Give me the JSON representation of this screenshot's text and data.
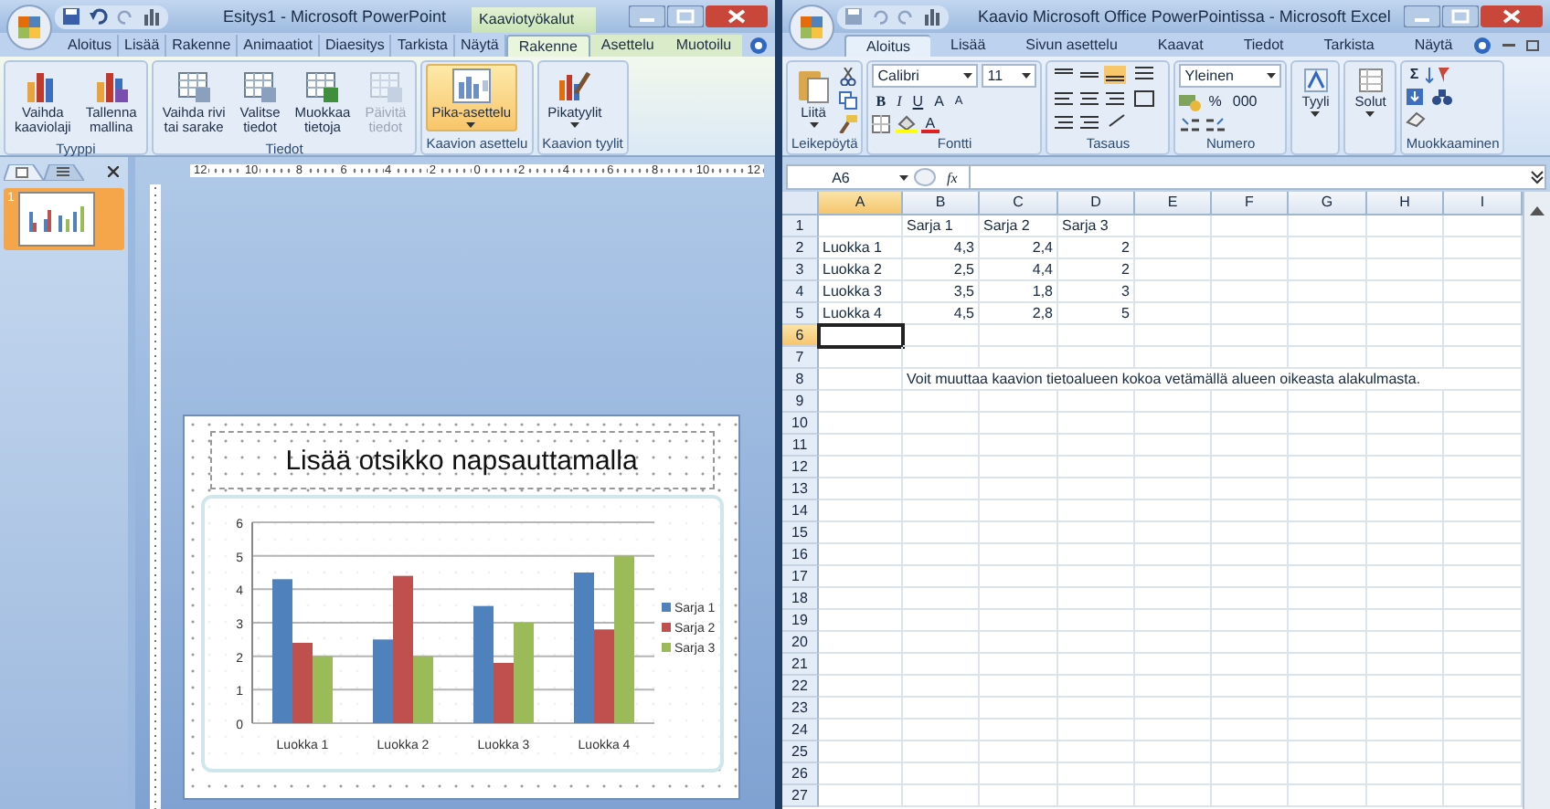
{
  "powerpoint": {
    "title": "Esitys1 - Microsoft PowerPoint",
    "context_title": "Kaaviotyökalut",
    "tabs": [
      {
        "label": "Aloitus",
        "selected": false,
        "contextual": false
      },
      {
        "label": "Lisää",
        "selected": false,
        "contextual": false
      },
      {
        "label": "Rakenne",
        "selected": false,
        "contextual": false
      },
      {
        "label": "Animaatiot",
        "selected": false,
        "contextual": false
      },
      {
        "label": "Diaesitys",
        "selected": false,
        "contextual": false
      },
      {
        "label": "Tarkista",
        "selected": false,
        "contextual": false
      },
      {
        "label": "Näytä",
        "selected": false,
        "contextual": false
      },
      {
        "label": "Rakenne",
        "selected": true,
        "contextual": true
      },
      {
        "label": "Asettelu",
        "selected": false,
        "contextual": true
      },
      {
        "label": "Muotoilu",
        "selected": false,
        "contextual": true
      }
    ],
    "groups": [
      {
        "label": "Tyyppi",
        "buttons": [
          {
            "label": "Vaihda\nkaaviolaji",
            "disabled": false,
            "pressed": false,
            "dropdown": false
          },
          {
            "label": "Tallenna\nmallina",
            "disabled": false,
            "pressed": false,
            "dropdown": false
          }
        ]
      },
      {
        "label": "Tiedot",
        "buttons": [
          {
            "label": "Vaihda rivi\ntai sarake",
            "disabled": false,
            "pressed": false,
            "dropdown": false
          },
          {
            "label": "Valitse\ntiedot",
            "disabled": false,
            "pressed": false,
            "dropdown": false
          },
          {
            "label": "Muokkaa\ntietoja",
            "disabled": false,
            "pressed": false,
            "dropdown": false
          },
          {
            "label": "Päivitä\ntiedot",
            "disabled": true,
            "pressed": false,
            "dropdown": false
          }
        ]
      },
      {
        "label": "Kaavion asettelu",
        "buttons": [
          {
            "label": "Pika-asettelu",
            "disabled": false,
            "pressed": true,
            "dropdown": true
          }
        ]
      },
      {
        "label": "Kaavion tyylit",
        "buttons": [
          {
            "label": "Pikatyylit",
            "disabled": false,
            "pressed": false,
            "dropdown": true
          }
        ]
      }
    ],
    "slides": [
      {
        "number": "1",
        "selected": true
      }
    ],
    "ruler": [
      "12",
      "10",
      "8",
      "6",
      "4",
      "2",
      "0",
      "2",
      "4",
      "6",
      "8",
      "10",
      "12"
    ],
    "slide": {
      "title_placeholder": "Lisää otsikko napsauttamalla",
      "chart_data": {
        "type": "bar",
        "grid": true,
        "legend": true,
        "categories": [
          "Luokka 1",
          "Luokka 2",
          "Luokka 3",
          "Luokka 4"
        ],
        "ylim": [
          0,
          6
        ],
        "yticks": [
          0,
          1,
          2,
          3,
          4,
          5,
          6
        ],
        "series": [
          {
            "name": "Sarja 1",
            "color": "#4f81bd",
            "values": [
              4.3,
              2.5,
              3.5,
              4.5
            ]
          },
          {
            "name": "Sarja 2",
            "color": "#c0504d",
            "values": [
              2.4,
              4.4,
              1.8,
              2.8
            ]
          },
          {
            "name": "Sarja 3",
            "color": "#9bbb59",
            "values": [
              2,
              2,
              3,
              5
            ]
          }
        ]
      }
    }
  },
  "excel": {
    "title": "Kaavio Microsoft Office PowerPointissa - Microsoft Excel",
    "tabs": [
      {
        "label": "Aloitus",
        "selected": true
      },
      {
        "label": "Lisää",
        "selected": false
      },
      {
        "label": "Sivun asettelu",
        "selected": false
      },
      {
        "label": "Kaavat",
        "selected": false
      },
      {
        "label": "Tiedot",
        "selected": false
      },
      {
        "label": "Tarkista",
        "selected": false
      },
      {
        "label": "Näytä",
        "selected": false
      }
    ],
    "ribbon": {
      "clipboard": {
        "paste": "Liitä",
        "label": "Leikepöytä"
      },
      "font": {
        "name": "Calibri",
        "size": "11",
        "bold": "B",
        "italic": "I",
        "underline": "U",
        "grow": "A",
        "shrink": "A",
        "color_button": "A",
        "label": "Fontti"
      },
      "alignment": {
        "label": "Tasaus"
      },
      "number": {
        "format": "Yleinen",
        "percent": "%",
        "thousands": "000",
        "label": "Numero"
      },
      "styles": {
        "button": "Tyyli"
      },
      "cells": {
        "button": "Solut"
      },
      "editing": {
        "sum": "Σ",
        "label": "Muokkaaminen"
      }
    },
    "name_box": "A6",
    "function_label": "fx",
    "columns": [
      {
        "label": "A",
        "selected": true
      },
      {
        "label": "B",
        "selected": false
      },
      {
        "label": "C",
        "selected": false
      },
      {
        "label": "D",
        "selected": false
      },
      {
        "label": "E",
        "selected": false
      },
      {
        "label": "F",
        "selected": false
      },
      {
        "label": "G",
        "selected": false
      },
      {
        "label": "H",
        "selected": false
      },
      {
        "label": "I",
        "selected": false
      }
    ],
    "rows": [
      {
        "number": "1",
        "selected": false,
        "cells": [
          {},
          {
            "text": "Sarja 1",
            "kind": "text"
          },
          {
            "text": "Sarja 2",
            "kind": "text"
          },
          {
            "text": "Sarja 3",
            "kind": "text"
          }
        ]
      },
      {
        "number": "2",
        "selected": false,
        "cells": [
          {
            "text": "Luokka 1",
            "kind": "text"
          },
          {
            "text": "4,3",
            "kind": "number"
          },
          {
            "text": "2,4",
            "kind": "number"
          },
          {
            "text": "2",
            "kind": "number"
          }
        ]
      },
      {
        "number": "3",
        "selected": false,
        "cells": [
          {
            "text": "Luokka 2",
            "kind": "text"
          },
          {
            "text": "2,5",
            "kind": "number"
          },
          {
            "text": "4,4",
            "kind": "number"
          },
          {
            "text": "2",
            "kind": "number"
          }
        ]
      },
      {
        "number": "4",
        "selected": false,
        "cells": [
          {
            "text": "Luokka 3",
            "kind": "text"
          },
          {
            "text": "3,5",
            "kind": "number"
          },
          {
            "text": "1,8",
            "kind": "number"
          },
          {
            "text": "3",
            "kind": "number"
          }
        ]
      },
      {
        "number": "5",
        "selected": false,
        "cells": [
          {
            "text": "Luokka 4",
            "kind": "text"
          },
          {
            "text": "4,5",
            "kind": "number"
          },
          {
            "text": "2,8",
            "kind": "number"
          },
          {
            "text": "5",
            "kind": "number"
          }
        ]
      },
      {
        "number": "6",
        "selected": true
      },
      {
        "number": "7",
        "selected": false
      },
      {
        "number": "8",
        "selected": false,
        "cells": [
          {},
          {
            "text": "Voit muuttaa kaavion tietoalueen kokoa vetämällä alueen oikeasta alakulmasta.",
            "kind": "note"
          }
        ]
      },
      {
        "number": "9",
        "selected": false
      },
      {
        "number": "10",
        "selected": false
      },
      {
        "number": "11",
        "selected": false
      },
      {
        "number": "12",
        "selected": false
      },
      {
        "number": "13",
        "selected": false
      },
      {
        "number": "14",
        "selected": false
      },
      {
        "number": "15",
        "selected": false
      },
      {
        "number": "16",
        "selected": false
      },
      {
        "number": "17",
        "selected": false
      },
      {
        "number": "18",
        "selected": false
      },
      {
        "number": "19",
        "selected": false
      },
      {
        "number": "20",
        "selected": false
      },
      {
        "number": "21",
        "selected": false
      },
      {
        "number": "22",
        "selected": false
      },
      {
        "number": "23",
        "selected": false
      },
      {
        "number": "24",
        "selected": false
      },
      {
        "number": "25",
        "selected": false
      },
      {
        "number": "26",
        "selected": false
      },
      {
        "number": "27",
        "selected": false
      }
    ]
  }
}
